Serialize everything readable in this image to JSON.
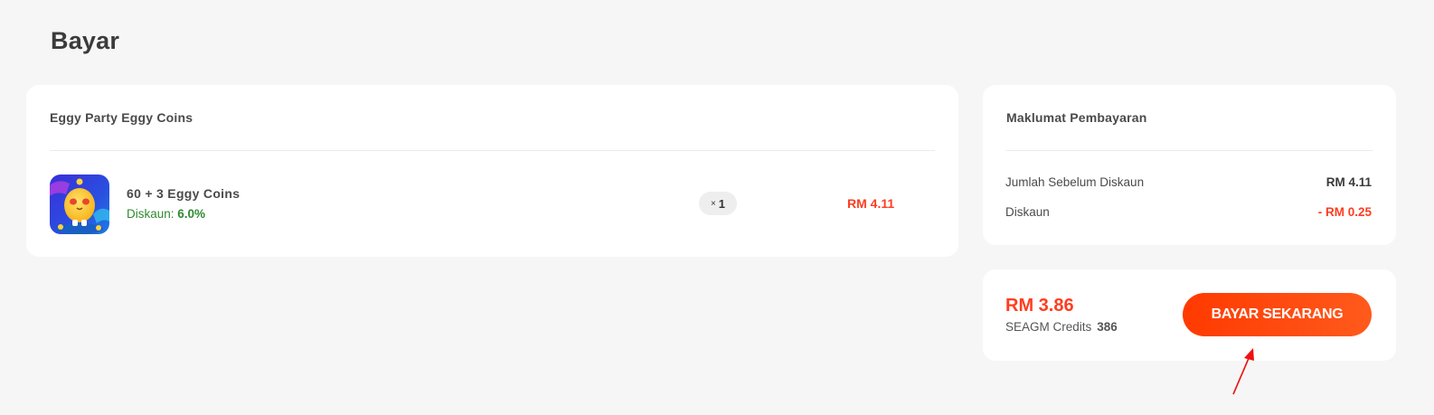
{
  "page": {
    "title": "Bayar"
  },
  "order": {
    "heading": "Eggy Party Eggy Coins",
    "item": {
      "icon": "eggy-party-game-icon",
      "name": "60 + 3 Eggy Coins",
      "discount_label": "Diskaun: ",
      "discount_value": "6.0%",
      "qty_prefix": "×",
      "qty": "1",
      "price": "RM 4.11"
    }
  },
  "payment_info": {
    "heading": "Maklumat Pembayaran",
    "rows": [
      {
        "label": "Jumlah Sebelum Diskaun",
        "value": "RM 4.11"
      },
      {
        "label": "Diskaun",
        "value": "- RM 0.25"
      }
    ]
  },
  "checkout": {
    "total": "RM 3.86",
    "credits_label": "SEAGM Credits",
    "credits_value": "386",
    "pay_button": "BAYAR SEKARANG"
  },
  "colors": {
    "accent": "#ff3d1f",
    "discount_green": "#2f8a2f",
    "background": "#f6f6f6",
    "annotation": "#ee1111"
  }
}
